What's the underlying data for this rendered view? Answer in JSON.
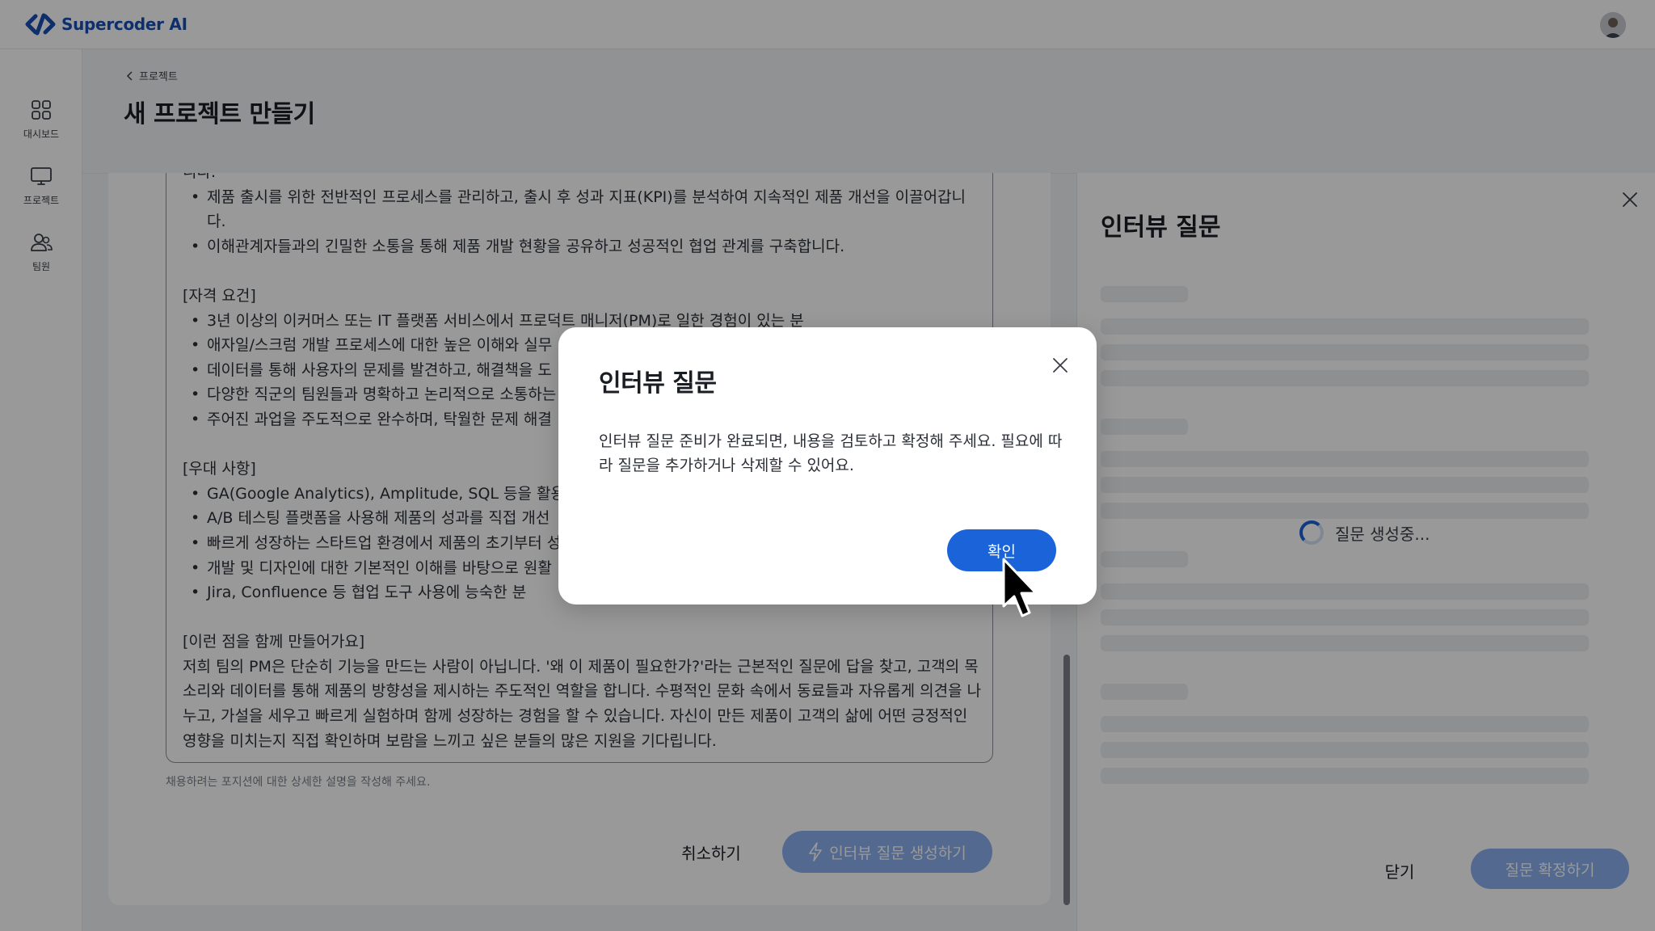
{
  "app": {
    "name": "Supercoder AI",
    "brand_color": "#1a4fb5"
  },
  "sidebar": {
    "items": [
      {
        "label": "대시보드",
        "icon": "dashboard-grid-icon"
      },
      {
        "label": "프로젝트",
        "icon": "monitor-icon"
      },
      {
        "label": "팀원",
        "icon": "team-icon"
      }
    ]
  },
  "page": {
    "breadcrumb": "프로젝트",
    "title": "새 프로젝트 만들기"
  },
  "form": {
    "description_lines": {
      "partial_top": "니다.",
      "resp_bullets": [
        "제품 출시를 위한 전반적인 프로세스를 관리하고, 출시 후 성과 지표(KPI)를 분석하여 지속적인 제품 개선을 이끌어갑니다.",
        "이해관계자들과의 긴밀한 소통을 통해 제품 개발 현황을 공유하고 성공적인 협업 관계를 구축합니다."
      ],
      "qual_heading": "[자격 요건]",
      "qual_bullets": [
        "3년 이상의 이커머스 또는 IT 플랫폼 서비스에서 프로덕트 매니저(PM)로 일한 경험이 있는 분",
        "애자일/스크럼 개발 프로세스에 대한 높은 이해와 실무",
        "데이터를 통해 사용자의 문제를 발견하고, 해결책을 도",
        "다양한 직군의 팀원들과 명확하고 논리적으로 소통하는",
        "주어진 과업을 주도적으로 완수하며, 탁월한 문제 해결"
      ],
      "pref_heading": "[우대 사항]",
      "pref_bullets": [
        "GA(Google Analytics), Amplitude, SQL 등을 활용하",
        "A/B 테스팅 플랫폼을 사용해 제품의 성과를 직접 개선",
        "빠르게 성장하는 스타트업 환경에서 제품의 초기부터 성",
        "개발 및 디자인에 대한 기본적인 이해를 바탕으로 원활",
        "Jira, Confluence 등 협업 도구 사용에 능숙한 분"
      ],
      "together_heading": "[이런 점을 함께 만들어가요]",
      "together_text": "저희 팀의 PM은 단순히 기능을 만드는 사람이 아닙니다. '왜 이 제품이 필요한가?'라는 근본적인 질문에 답을 찾고, 고객의 목소리와 데이터를 통해 제품의 방향성을 제시하는 주도적인 역할을 합니다. 수평적인 문화 속에서 동료들과 자유롭게 의견을 나누고, 가설을 세우고 빠르게 실험하며 함께 성장하는 경험을 할 수 있습니다. 자신이 만든 제품이 고객의 삶에 어떤 긍정적인 영향을 미치는지 직접 확인하며 보람을 느끼고 싶은 분들의 많은 지원을 기다립니다."
    },
    "help_text": "채용하려는 포지션에 대한 상세한 설명을 작성해 주세요.",
    "cancel_label": "취소하기",
    "generate_label": "인터뷰 질문 생성하기"
  },
  "panel": {
    "title": "인터뷰 질문",
    "loading_text": "질문 생성중...",
    "close_label": "닫기",
    "confirm_label": "질문 확정하기"
  },
  "modal": {
    "title": "인터뷰 질문",
    "body": "인터뷰 질문 준비가 완료되면, 내용을 검토하고 확정해 주세요. 필요에 따라 질문을 추가하거나 삭제할 수 있어요.",
    "ok_label": "확인",
    "accent": "#1b63d8"
  }
}
